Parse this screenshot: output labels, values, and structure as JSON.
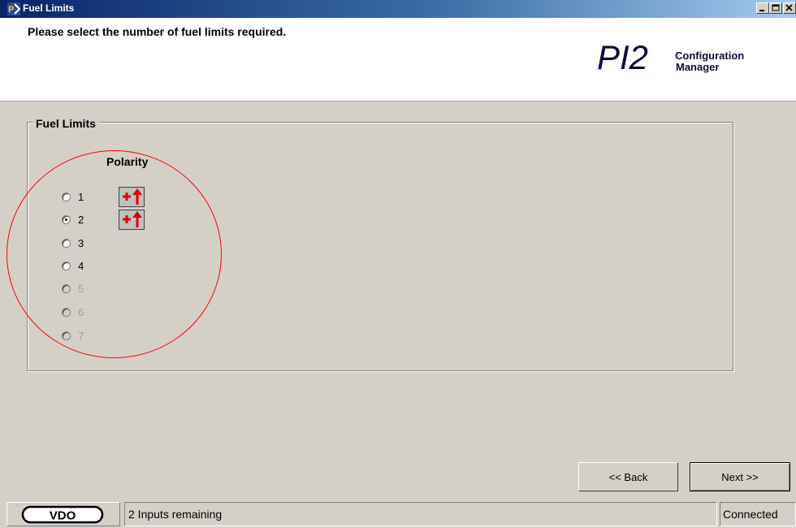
{
  "window": {
    "title": "Fuel Limits",
    "app_icon": "pi2-app-icon",
    "controls": [
      "minimize-icon",
      "maximize-icon",
      "close-icon"
    ]
  },
  "header": {
    "instruction": "Please select the number of fuel limits required.",
    "logo": {
      "main": "PI2",
      "sub_line1": "Configuration",
      "sub_line2": "Manager"
    }
  },
  "group": {
    "legend": "Fuel Limits",
    "polarity_header": "Polarity",
    "options": [
      {
        "label": "1",
        "checked": false,
        "enabled": true
      },
      {
        "label": "2",
        "checked": true,
        "enabled": true
      },
      {
        "label": "3",
        "checked": false,
        "enabled": true
      },
      {
        "label": "4",
        "checked": false,
        "enabled": true
      },
      {
        "label": "5",
        "checked": false,
        "enabled": false
      },
      {
        "label": "6",
        "checked": false,
        "enabled": false
      },
      {
        "label": "7",
        "checked": false,
        "enabled": false
      }
    ],
    "polarity_buttons": [
      {
        "icon": "positive-up-arrow-icon"
      },
      {
        "icon": "positive-up-arrow-icon"
      }
    ]
  },
  "buttons": {
    "back": "<< Back",
    "next": "Next >>"
  },
  "statusbar": {
    "logo": "VDO",
    "message": "2 Inputs remaining",
    "connection": "Connected"
  },
  "colors": {
    "title_gradient_start": "#0a246a",
    "title_gradient_end": "#a6caf0",
    "highlight": "#ff0000",
    "polarity_icon": "#e00000"
  }
}
